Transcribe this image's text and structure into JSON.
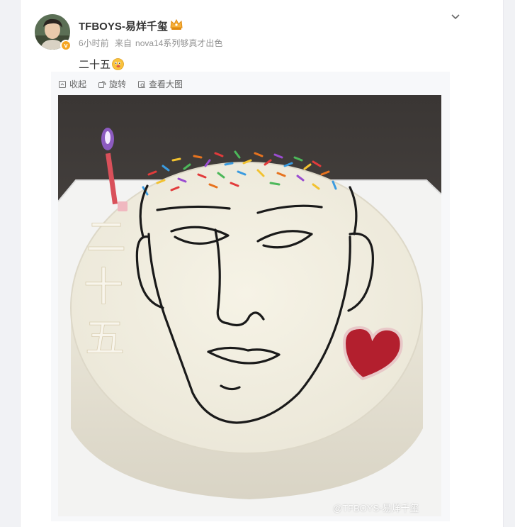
{
  "post": {
    "username": "TFBOYS-易烊千玺",
    "time": "6小时前",
    "source_prefix": "来自",
    "source": "nova14系列够真才出色",
    "text": "二十五"
  },
  "toolbar": {
    "collapse_label": "收起",
    "rotate_label": "旋转",
    "view_large_label": "查看大图"
  },
  "image": {
    "cake_text": [
      "二",
      "十",
      "五"
    ],
    "watermark": "@TFBOYS-易烊千玺"
  },
  "colors": {
    "accent": "#f6a623",
    "text": "#333333",
    "muted": "#939393"
  }
}
